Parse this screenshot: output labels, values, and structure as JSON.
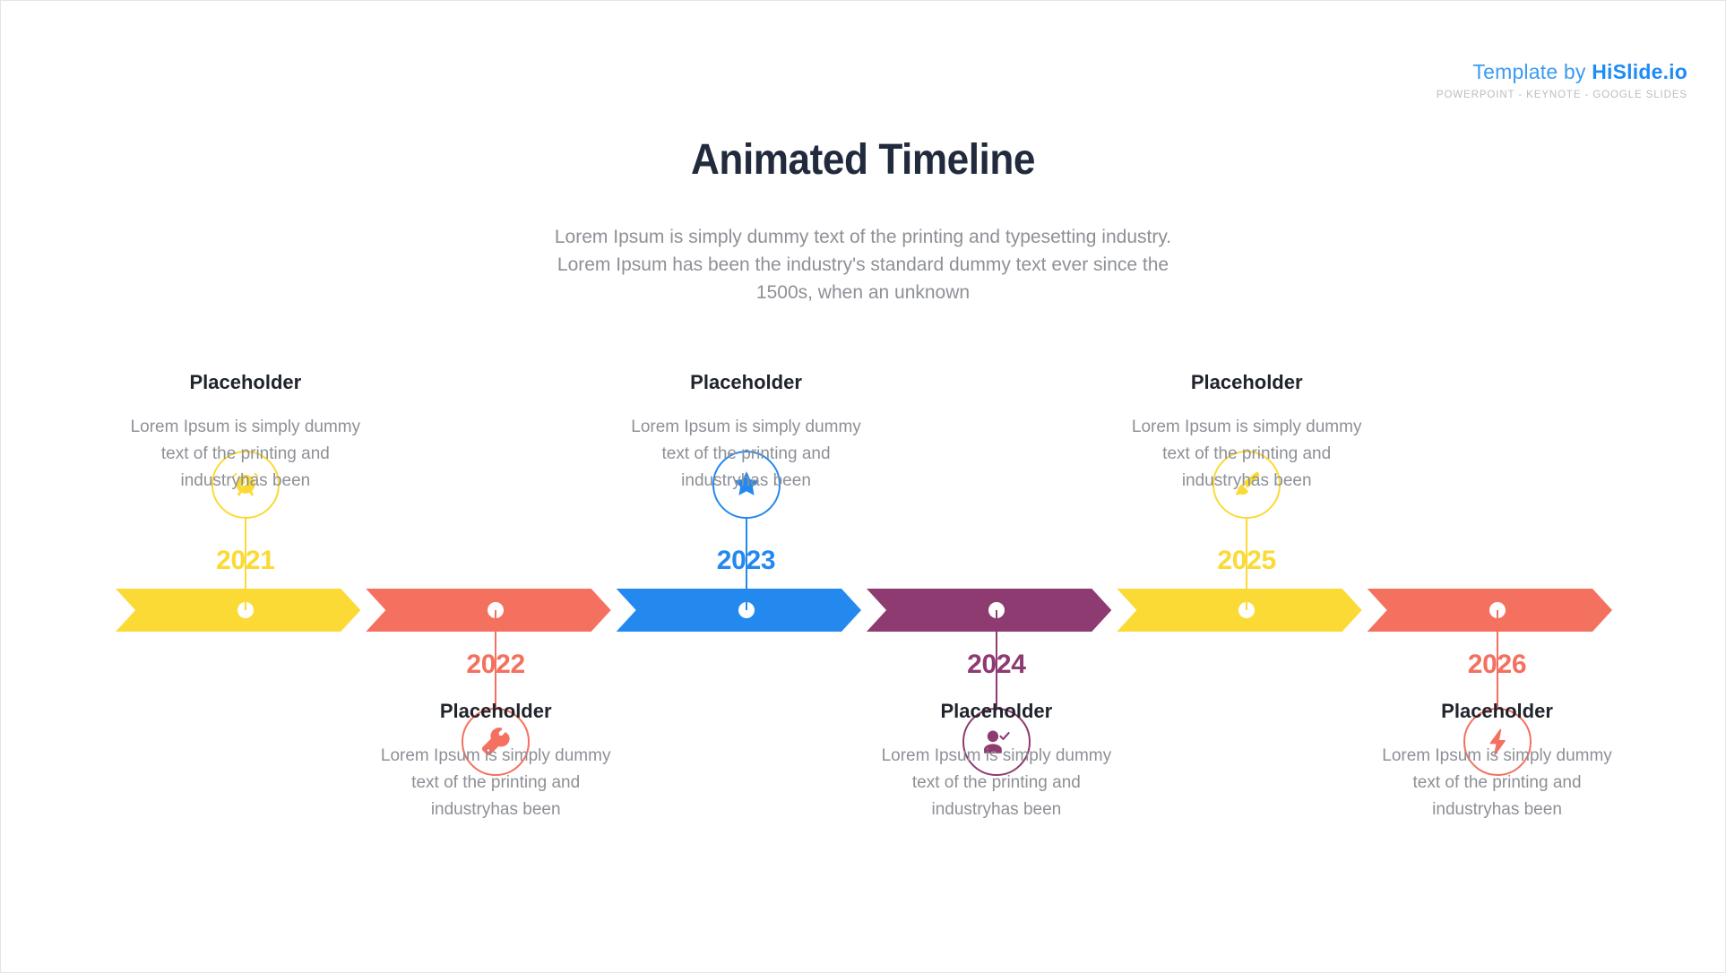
{
  "brand": {
    "prefix": "Template by ",
    "name": "HiSlide.io",
    "subline": "POWERPOINT - KEYNOTE - GOOGLE SLIDES",
    "color": "#1f8cf5"
  },
  "header": {
    "title": "Animated Timeline",
    "subtitle": "Lorem Ipsum is simply dummy text of the printing and typesetting industry. Lorem Ipsum has been the industry's standard dummy text ever since the 1500s, when an unknown"
  },
  "timeline": {
    "items": [
      {
        "year": "2021",
        "color": "#fbda36",
        "icon": "alarm-clock-icon",
        "side": "above",
        "title": "Placeholder",
        "body": "Lorem Ipsum is simply dummy text of the printing and industryhas been"
      },
      {
        "year": "2022",
        "color": "#f4705f",
        "icon": "wrench-icon",
        "side": "below",
        "title": "Placeholder",
        "body": "Lorem Ipsum is simply dummy text of the printing and industryhas been"
      },
      {
        "year": "2023",
        "color": "#2489ef",
        "icon": "star-icon",
        "side": "above",
        "title": "Placeholder",
        "body": "Lorem Ipsum is simply dummy text of the printing and industryhas been"
      },
      {
        "year": "2024",
        "color": "#8e3b72",
        "icon": "user-check-icon",
        "side": "below",
        "title": "Placeholder",
        "body": "Lorem Ipsum is simply dummy text of the printing and industryhas been"
      },
      {
        "year": "2025",
        "color": "#fbda36",
        "icon": "paintbrush-icon",
        "side": "above",
        "title": "Placeholder",
        "body": "Lorem Ipsum is simply dummy text of the printing and industryhas been"
      },
      {
        "year": "2026",
        "color": "#f4705f",
        "icon": "lightning-bolt-icon",
        "side": "below",
        "title": "Placeholder",
        "body": "Lorem Ipsum is simply dummy text of the printing and industryhas been"
      }
    ]
  }
}
